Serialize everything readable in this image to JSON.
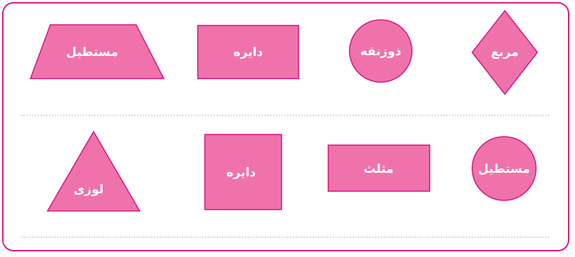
{
  "page": {
    "theme_color": "#e0198b",
    "shape_fill": "#ef73aa"
  },
  "row1": [
    {
      "shape": "trapezoid",
      "label": "مستطیل"
    },
    {
      "shape": "rectangle",
      "label": "دایره"
    },
    {
      "shape": "circle",
      "label": "ذوزنقه"
    },
    {
      "shape": "rhombus",
      "label": "مربع"
    }
  ],
  "row2": [
    {
      "shape": "triangle",
      "label": "لوزی"
    },
    {
      "shape": "square",
      "label": "دایره"
    },
    {
      "shape": "rectangle",
      "label": "مثلث"
    },
    {
      "shape": "circle",
      "label": "مستطیل"
    }
  ]
}
